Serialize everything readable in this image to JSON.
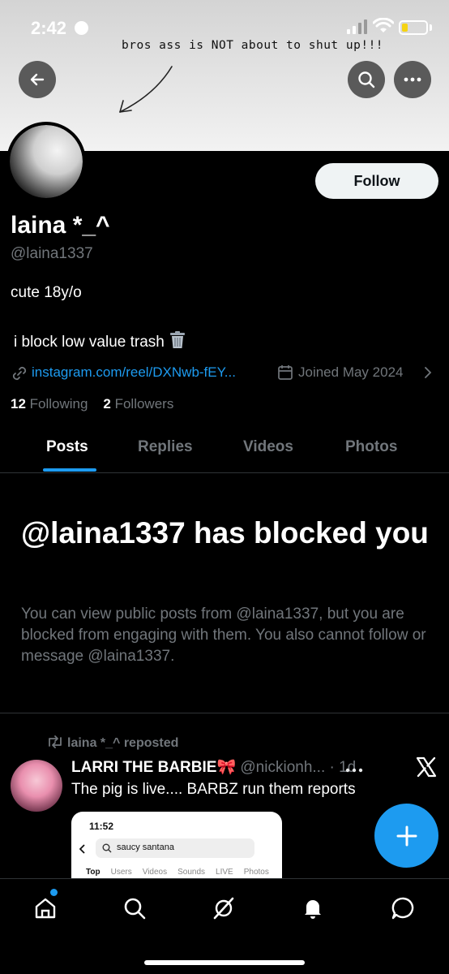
{
  "status_bar": {
    "time": "2:42"
  },
  "banner": {
    "caption": "bros ass is NOT about to shut up!!!"
  },
  "header": {
    "back_icon": "arrow-left-icon",
    "search_icon": "search-icon",
    "more_icon": "more-horizontal-icon"
  },
  "profile": {
    "follow_label": "Follow",
    "display_name": "laina *_^",
    "handle": "@laina1337",
    "bio_line1": "cute 18y/o",
    "bio_line2": "i block low value trash",
    "link": "instagram.com/reel/DXNwb-fEY...",
    "joined": "Joined May 2024",
    "following_count": "12",
    "following_label": "Following",
    "followers_count": "2",
    "followers_label": "Followers"
  },
  "tabs": [
    {
      "label": "Posts",
      "active": true
    },
    {
      "label": "Replies",
      "active": false
    },
    {
      "label": "Videos",
      "active": false
    },
    {
      "label": "Photos",
      "active": false
    }
  ],
  "blocked": {
    "title": "@laina1337 has blocked you",
    "description": "You can view public posts from @laina1337, but you are blocked from engaging with them. You also cannot follow or message @laina1337."
  },
  "post": {
    "repost_label": "laina *_^ reposted",
    "author_name": "LARRI THE BARBIE🎀",
    "author_meta": "@nickionh... · 1d",
    "text": "The pig is live.... BARBZ run them reports",
    "embedded": {
      "time": "11:52",
      "search_text": "saucy santana",
      "tabs": [
        "Top",
        "Users",
        "Videos",
        "Sounds",
        "LIVE",
        "Photos"
      ]
    }
  },
  "colors": {
    "accent": "#1d9bf0",
    "background": "#000000",
    "muted": "#71767b"
  },
  "bottom_nav": [
    "home-icon",
    "search-icon",
    "grok-icon",
    "notifications-icon",
    "messages-icon"
  ]
}
